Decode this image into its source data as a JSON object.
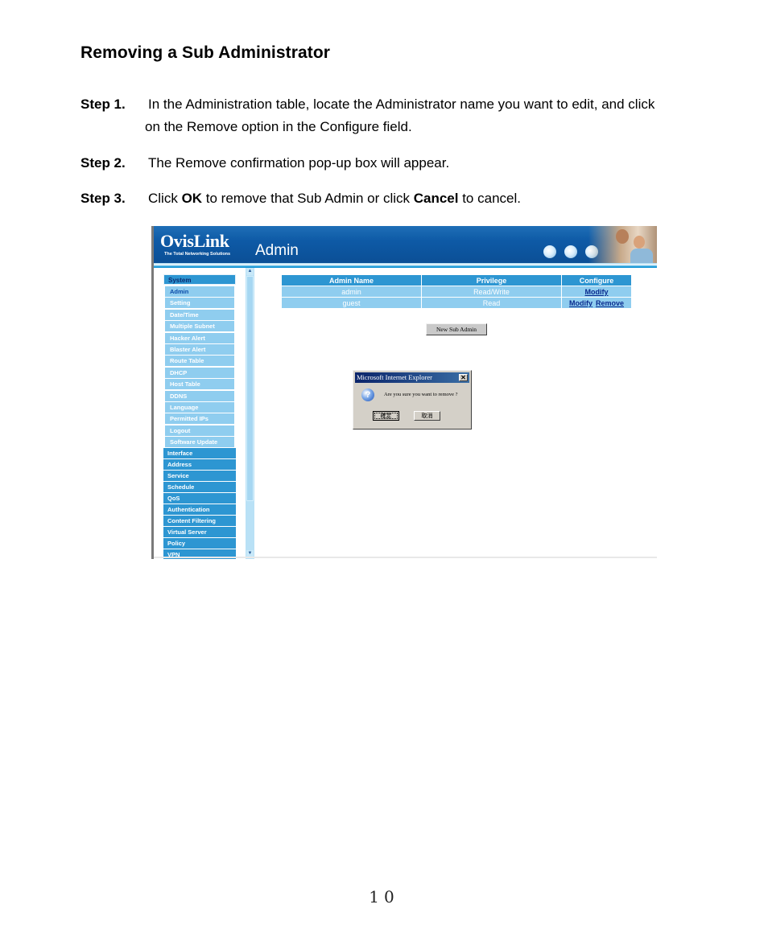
{
  "document": {
    "title": "Removing a Sub Administrator",
    "steps": [
      {
        "label": "Step 1.",
        "text_line1": "In the Administration table, locate the Administrator name you want to edit, and click",
        "text_line2": "on the Remove option in the Configure field."
      },
      {
        "label": "Step 2.",
        "text": "The Remove confirmation pop-up box will appear."
      },
      {
        "label": "Step 3.",
        "text_pre": "Click ",
        "bold1": "OK",
        "text_mid": " to remove that Sub Admin or click ",
        "bold2": "Cancel",
        "text_post": " to cancel."
      }
    ],
    "page_number": "10"
  },
  "screenshot": {
    "banner": {
      "logo": "OvisLink",
      "tagline": "The Total Networking Solutions",
      "title": "Admin"
    },
    "sidebar": {
      "system_header": "System",
      "system_items": [
        {
          "label": "Admin",
          "active": true
        },
        {
          "label": "Setting"
        },
        {
          "label": "Date/Time"
        },
        {
          "label": "Multiple Subnet"
        },
        {
          "label": "Hacker Alert"
        },
        {
          "label": "Blaster Alert"
        },
        {
          "label": "Route Table"
        },
        {
          "label": "DHCP"
        },
        {
          "label": "Host Table"
        },
        {
          "label": "DDNS"
        },
        {
          "label": "Language"
        },
        {
          "label": "Permitted IPs"
        },
        {
          "label": "Logout"
        },
        {
          "label": "Software Update"
        }
      ],
      "main_items": [
        "Interface",
        "Address",
        "Service",
        "Schedule",
        "QoS",
        "Authentication",
        "Content Filtering",
        "Virtual Server",
        "Policy",
        "VPN"
      ]
    },
    "admin_table": {
      "headers": [
        "Admin Name",
        "Privilege",
        "Configure"
      ],
      "rows": [
        {
          "name": "admin",
          "privilege": "Read/Write",
          "actions": [
            "Modify"
          ]
        },
        {
          "name": "guest",
          "privilege": "Read",
          "actions": [
            "Modify",
            "Remove"
          ]
        }
      ]
    },
    "new_sub_admin_button": "New Sub Admin",
    "dialog": {
      "title": "Microsoft Internet Explorer",
      "close": "✕",
      "icon": "?",
      "message": "Are you sure you want to remove ?",
      "ok_label": "確定",
      "cancel_label": "取消"
    }
  }
}
